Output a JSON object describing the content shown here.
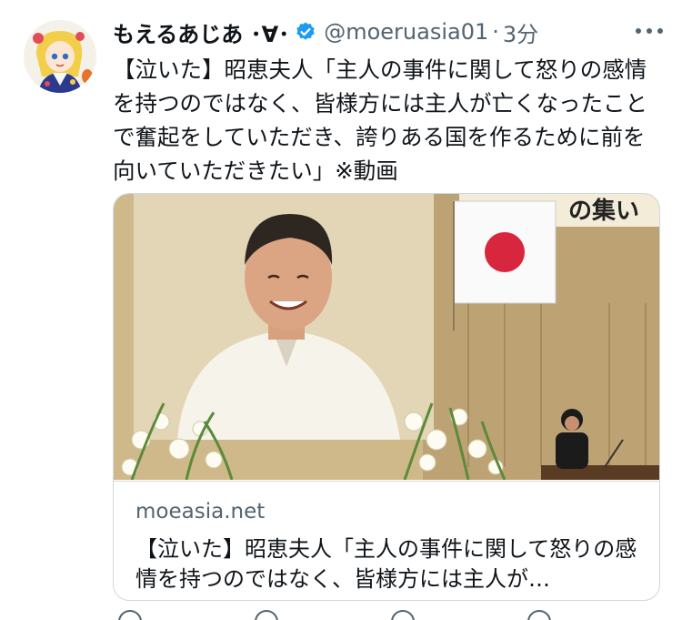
{
  "header": {
    "display_name": "もえるあじあ ･∀･",
    "handle": "@moeruasia01",
    "separator": "·",
    "time": "3分"
  },
  "tweet": {
    "text": "【泣いた】昭恵夫人「主人の事件に関して怒りの感情を持つのではなく、皆様方には主人が亡くなったことで奮起をしていただき、誇りある国を作るために前を向いていただきたい」※動画"
  },
  "card": {
    "domain": "moeasia.net",
    "title": "【泣いた】昭恵夫人「主人の事件に関して怒りの感情を持つのではなく、皆様方には主人が…",
    "banner_text": "の集い"
  },
  "icons": {
    "verified": "verified-badge-icon",
    "more": "more-options-icon"
  },
  "colors": {
    "verified": "#1d9bf0",
    "text_primary": "#0f1419",
    "text_secondary": "#536471",
    "border": "#cfd9de",
    "flag_red": "#d7263d"
  }
}
